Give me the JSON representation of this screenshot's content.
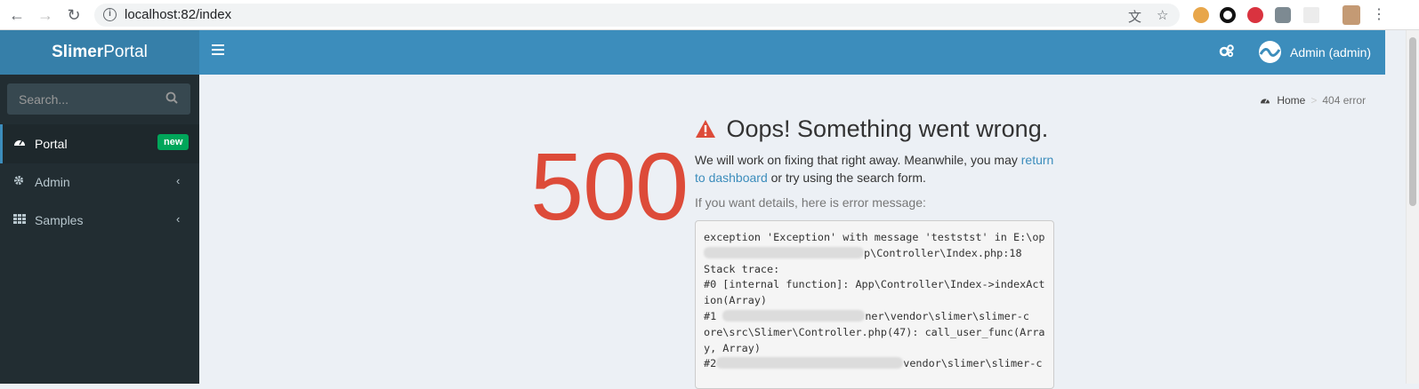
{
  "browser": {
    "url": "localhost:82/index"
  },
  "header": {
    "logo_bold": "Slimer",
    "logo_light": "Portal",
    "user": "Admin (admin)"
  },
  "sidebar": {
    "search_placeholder": "Search...",
    "items": [
      {
        "label": "Portal",
        "icon": "dashboard-icon",
        "badge": "new",
        "active": true
      },
      {
        "label": "Admin",
        "icon": "gear-icon"
      },
      {
        "label": "Samples",
        "icon": "grid-icon"
      }
    ]
  },
  "breadcrumb": {
    "home": "Home",
    "current": "404 error"
  },
  "error": {
    "code": "500",
    "title": "Oops! Something went wrong.",
    "msg_before": "We will work on fixing that right away. Meanwhile, you may ",
    "link": "return to dashboard",
    "msg_after": " or try using the search form.",
    "details_label": "If you want details, here is error message:",
    "trace_lines": [
      "exception 'Exception' with message 'teststst' in E:\\op",
      "p\\Controller\\Index.php:18",
      "Stack trace:",
      "#0 [internal function]: App\\Controller\\Index->indexAct",
      "ion(Array)",
      "ner\\vendor\\slimer\\slimer-c",
      "ore\\src\\Slimer\\Controller.php(47): call_user_func(Arra",
      "y, Array)",
      "vendor\\slimer\\slimer-c"
    ],
    "trace_prefix_1": "#1 ",
    "trace_prefix_2": "#2"
  },
  "colors": {
    "header": "#3c8dbc",
    "logo_bg": "#367fa9",
    "sidebar": "#222d32",
    "error_red": "#dd4b39",
    "badge_green": "#00a65a"
  }
}
